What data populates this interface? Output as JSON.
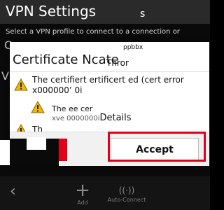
{
  "header": {
    "title": "VPN Settings",
    "ghost_s": "s"
  },
  "subtitle": "Select a VPN profile to connect to a connection or",
  "background": {
    "c": "C",
    "v": "V"
  },
  "dialog": {
    "title": "Certificate Ncate",
    "title_ghost": "Thror",
    "ghost_small": "ppbbx",
    "msg1_line1": "The certifiert ertificert ed (cert error",
    "msg1_line2": "x000000’ 0i",
    "msg2": "The ee cer",
    "details": "Details",
    "details_prefix": "xve 0000000i",
    "msg3": "Th",
    "accept_label": "Accept"
  },
  "bottom_bar": {
    "add_label": "Add",
    "auto_label": "Auto-Connect"
  },
  "colors": {
    "highlight": "#e10018",
    "dialog_bg": "#ffffff",
    "screen_bg": "#0a0a0a"
  },
  "icons": {
    "warning": "warning-icon",
    "back": "back-chevron-icon",
    "add": "add-icon",
    "auto": "radio-waves-icon"
  }
}
